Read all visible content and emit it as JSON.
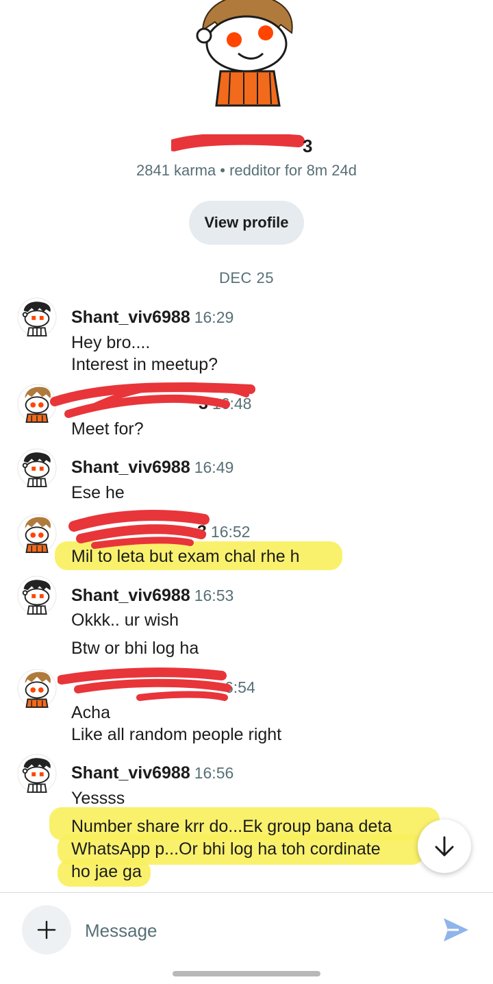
{
  "profile": {
    "name_visible_fragment": "3",
    "meta": "2841 karma • redditor for 8m 24d",
    "view_profile_label": "View profile"
  },
  "date_divider": "DEC 25",
  "messages": [
    {
      "user": "Shant_viv6988",
      "time": "16:29",
      "lines": [
        "Hey bro....",
        "Interest in meetup?"
      ]
    },
    {
      "user_visible_fragment": "3",
      "time": "16:48",
      "lines": [
        "Meet for?"
      ]
    },
    {
      "user": "Shant_viv6988",
      "time": "16:49",
      "lines": [
        "Ese he"
      ]
    },
    {
      "user_visible_fragment": "3",
      "time": "16:52",
      "lines": [
        "Mil to leta but exam chal rhe h"
      ],
      "highlighted": true
    },
    {
      "user": "Shant_viv6988",
      "time": "16:53",
      "lines": [
        "Okkk.. ur wish",
        "Btw or bhi log ha"
      ]
    },
    {
      "user_visible_fragment": "",
      "time": "6:54",
      "lines": [
        "Acha",
        "Like all random people right"
      ]
    },
    {
      "user": "Shant_viv6988",
      "time": "16:56",
      "lines": [
        "Yessss",
        "Number share krr do...Ek group bana deta",
        "WhatsApp p...Or bhi log ha toh cordinate",
        "ho jae ga"
      ],
      "highlighted_lines": [
        1,
        2,
        3
      ]
    }
  ],
  "composer": {
    "placeholder": "Message",
    "add_icon": "plus-icon",
    "send_icon": "send-icon"
  },
  "scroll_down_icon": "arrow-down-icon",
  "colors": {
    "highlight": "#f8f05c",
    "redaction": "#e8353a",
    "meta_text": "#576f76",
    "send_icon": "#8fb4ea"
  }
}
